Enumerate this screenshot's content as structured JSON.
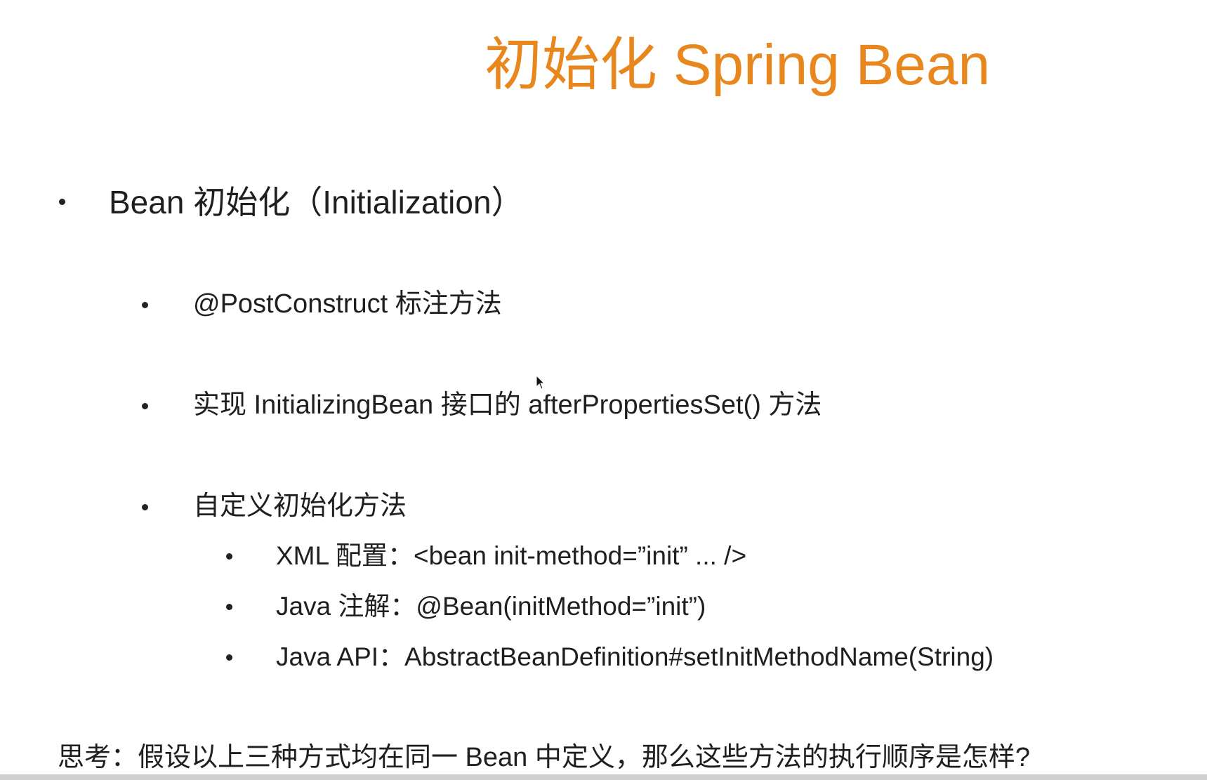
{
  "slide": {
    "title": "初始化 Spring Bean",
    "items": [
      {
        "label": "Bean 初始化（Initialization）"
      },
      {
        "label": "@PostConstruct 标注方法"
      },
      {
        "label": "实现 InitializingBean 接口的 afterPropertiesSet() 方法"
      },
      {
        "label": "自定义初始化方法"
      },
      {
        "label": "XML 配置：<bean init-method=”init” ... />"
      },
      {
        "label": "Java 注解：@Bean(initMethod=”init”)"
      },
      {
        "label": "Java API：AbstractBeanDefinition#setInitMethodName(String)"
      }
    ],
    "question": "思考：假设以上三种方式均在同一 Bean 中定义，那么这些方法的执行顺序是怎样?"
  },
  "colors": {
    "title": "#e8871e",
    "text": "#1f1f1f",
    "background": "#ffffff"
  },
  "icons": {
    "cursor": "mouse-pointer-icon"
  }
}
